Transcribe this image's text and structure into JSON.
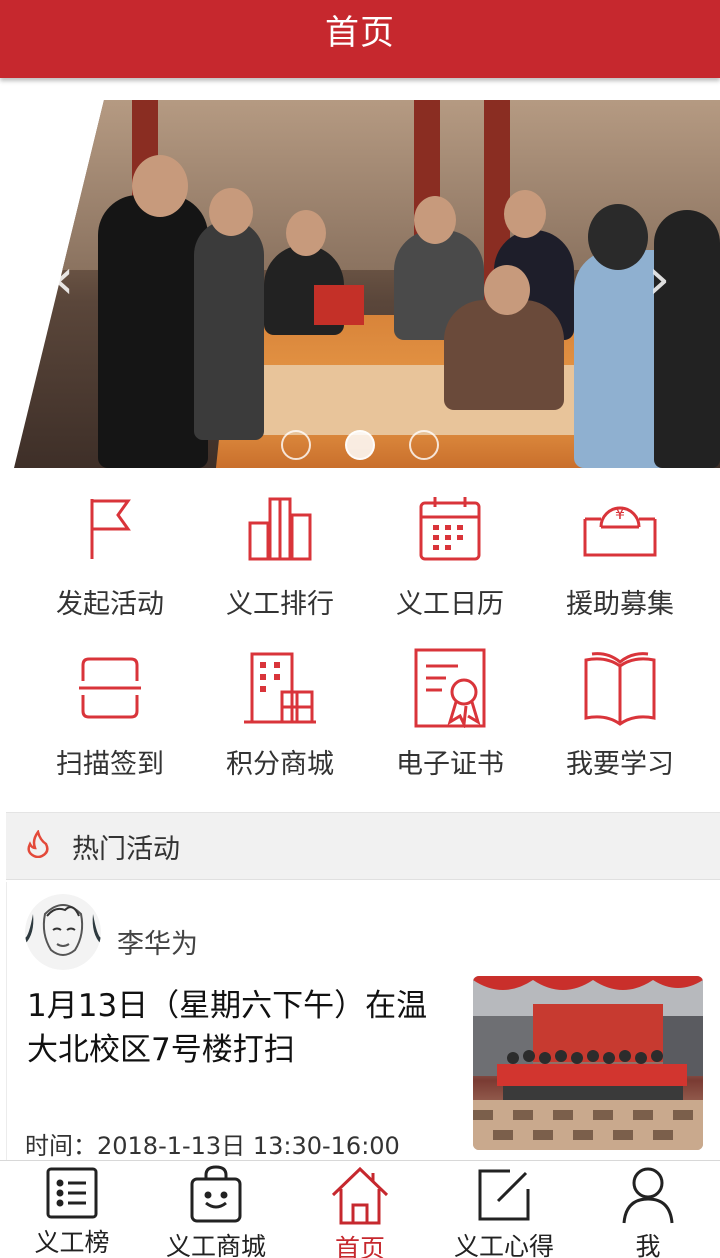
{
  "header": {
    "title": "首页"
  },
  "carousel": {
    "slide_count": 3,
    "active_index": 1
  },
  "grid": {
    "items": [
      {
        "label": "发起活动",
        "icon": "flag-icon"
      },
      {
        "label": "义工排行",
        "icon": "ranking-icon"
      },
      {
        "label": "义工日历",
        "icon": "calendar-icon"
      },
      {
        "label": "援助募集",
        "icon": "donation-icon"
      },
      {
        "label": "扫描签到",
        "icon": "scan-icon"
      },
      {
        "label": "积分商城",
        "icon": "mall-building-icon"
      },
      {
        "label": "电子证书",
        "icon": "certificate-icon"
      },
      {
        "label": "我要学习",
        "icon": "book-icon"
      }
    ]
  },
  "hot": {
    "title": "热门活动",
    "card": {
      "author": "李华为",
      "title": "1月13日（星期六下午）在温大北校区7号楼打扫",
      "time": "时间：2018-1-13日 13:30-16:00"
    }
  },
  "bottom_nav": {
    "items": [
      {
        "label": "义工榜",
        "icon": "list-icon"
      },
      {
        "label": "义工商城",
        "icon": "shopping-bag-icon"
      },
      {
        "label": "首页",
        "icon": "home-icon"
      },
      {
        "label": "义工心得",
        "icon": "edit-icon"
      },
      {
        "label": "我",
        "icon": "user-icon"
      }
    ],
    "active_index": 2
  },
  "colors": {
    "accent": "#c6282e",
    "icon_red": "#d9343a"
  }
}
